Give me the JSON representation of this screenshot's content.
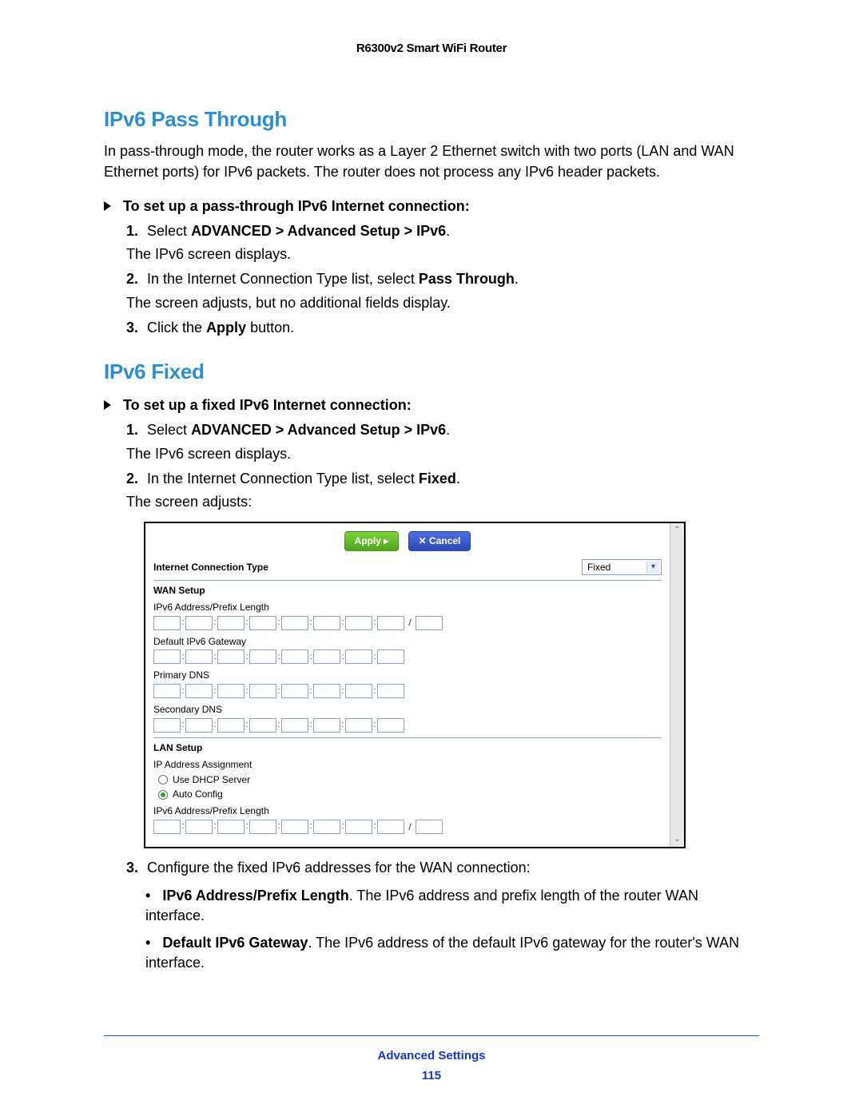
{
  "header": {
    "title": "R6300v2 Smart WiFi Router"
  },
  "sections": {
    "passThrough": {
      "heading": "IPv6 Pass Through",
      "intro": "In pass-through mode, the router works as a Layer 2 Ethernet switch with two ports (LAN and WAN Ethernet ports) for IPv6 packets. The router does not process any IPv6 header packets.",
      "procTitle": "To set up a pass-through IPv6 Internet connection:",
      "steps": {
        "s1a": "Select ",
        "s1b": "ADVANCED > Advanced Setup > IPv6",
        "s1c": ".",
        "s1sub": "The IPv6 screen displays.",
        "s2a": "In the Internet Connection Type list, select ",
        "s2b": "Pass Through",
        "s2c": ".",
        "s2sub": "The screen adjusts, but no additional fields display.",
        "s3a": "Click the ",
        "s3b": "Apply",
        "s3c": " button."
      }
    },
    "fixed": {
      "heading": "IPv6 Fixed",
      "procTitle": "To set up a fixed IPv6 Internet connection:",
      "steps": {
        "s1a": "Select ",
        "s1b": "ADVANCED > Advanced Setup > IPv6",
        "s1c": ".",
        "s1sub": "The IPv6 screen displays.",
        "s2a": "In the Internet Connection Type list, select ",
        "s2b": "Fixed",
        "s2c": ".",
        "s2sub": "The screen adjusts:",
        "s3": "Configure the fixed IPv6 addresses for the WAN connection:"
      },
      "bullets": {
        "b1t": "IPv6 Address/Prefix Length",
        "b1r": ". The IPv6 address and prefix length of the router WAN interface.",
        "b2t": "Default IPv6 Gateway",
        "b2r": ". The IPv6 address of the default IPv6 gateway for the router's WAN interface."
      }
    }
  },
  "screenshot": {
    "applyLabel": "Apply ▸",
    "cancelLabel": "✕ Cancel",
    "connTypeLabel": "Internet Connection Type",
    "connTypeValue": "Fixed",
    "wanSetup": "WAN Setup",
    "wanAddr": "IPv6 Address/Prefix Length",
    "defGw": "Default IPv6 Gateway",
    "primDns": "Primary DNS",
    "secDns": "Secondary DNS",
    "lanSetup": "LAN Setup",
    "ipAssign": "IP Address Assignment",
    "useDhcp": "Use DHCP Server",
    "autoCfg": "Auto Config",
    "lanAddr": "IPv6 Address/Prefix Length"
  },
  "footer": {
    "section": "Advanced Settings",
    "page": "115"
  }
}
